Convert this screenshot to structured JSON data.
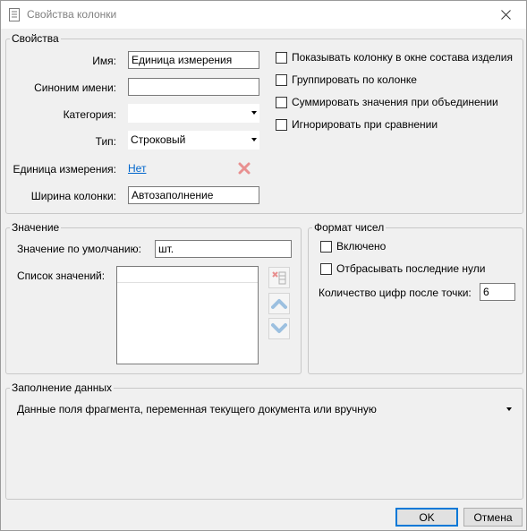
{
  "window": {
    "title": "Свойства колонки",
    "icon": "document-icon"
  },
  "properties": {
    "legend": "Свойства",
    "name_label": "Имя:",
    "name_value": "Единица измерения",
    "synonym_label": "Синоним имени:",
    "synonym_value": "",
    "category_label": "Категория:",
    "category_value": "",
    "type_label": "Тип:",
    "type_value": "Строковый",
    "unit_label": "Единица измерения:",
    "unit_value": "Нет",
    "width_label": "Ширина колонки:",
    "width_value": "Автозаполнение",
    "checkboxes": [
      {
        "label": "Показывать колонку в окне состава изделия",
        "checked": false
      },
      {
        "label": "Группировать по колонке",
        "checked": false
      },
      {
        "label": "Суммировать значения при объединении",
        "checked": false
      },
      {
        "label": "Игнорировать при сравнении",
        "checked": false
      }
    ]
  },
  "value": {
    "legend": "Значение",
    "default_label": "Значение по умолчанию:",
    "default_value": "шт.",
    "list_label": "Список значений:"
  },
  "number_format": {
    "legend": "Формат чисел",
    "enabled_label": "Включено",
    "enabled": false,
    "trim_zeros_label": "Отбрасывать последние нули",
    "trim_zeros": false,
    "digits_label": "Количество цифр после точки:",
    "digits_value": "6"
  },
  "fill": {
    "legend": "Заполнение данных",
    "mode_value": "Данные поля фрагмента, переменная текущего документа или вручную"
  },
  "buttons": {
    "ok": "OK",
    "cancel": "Отмена"
  },
  "colors": {
    "accent": "#0078d7",
    "link": "#0066cc",
    "delete_red": "#e06060",
    "arrow_blue": "#6aa0d0"
  }
}
